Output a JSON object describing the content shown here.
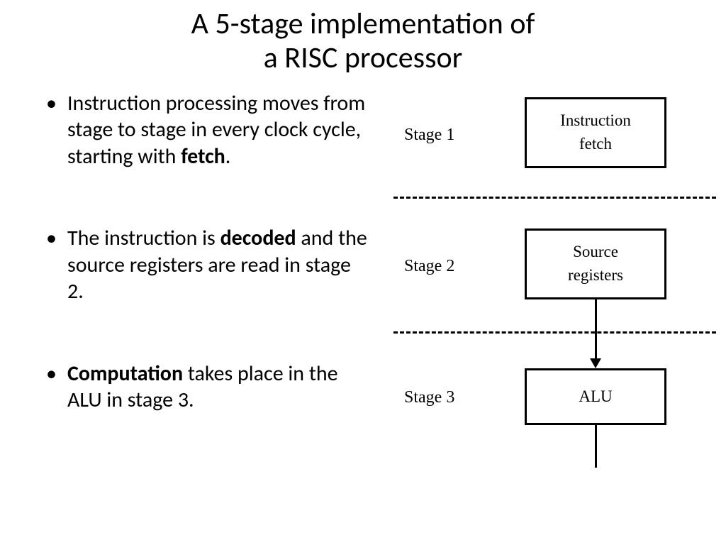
{
  "title_line1": "A 5-stage implementation of",
  "title_line2": "a RISC processor",
  "bullets": {
    "b1_pre": "Instruction processing moves from stage to stage in every clock cycle, starting with ",
    "b1_bold": "fetch",
    "b1_post": ".",
    "b2_pre": "The instruction is ",
    "b2_bold": "decoded",
    "b2_post": " and the source registers are read in stage 2.",
    "b3_bold": "Computation",
    "b3_post": " takes place in the ALU in stage 3."
  },
  "diagram": {
    "stage1_label": "Stage 1",
    "stage2_label": "Stage 2",
    "stage3_label": "Stage 3",
    "box1_line1": "Instruction",
    "box1_line2": "fetch",
    "box2_line1": "Source",
    "box2_line2": "registers",
    "box3": "ALU"
  }
}
